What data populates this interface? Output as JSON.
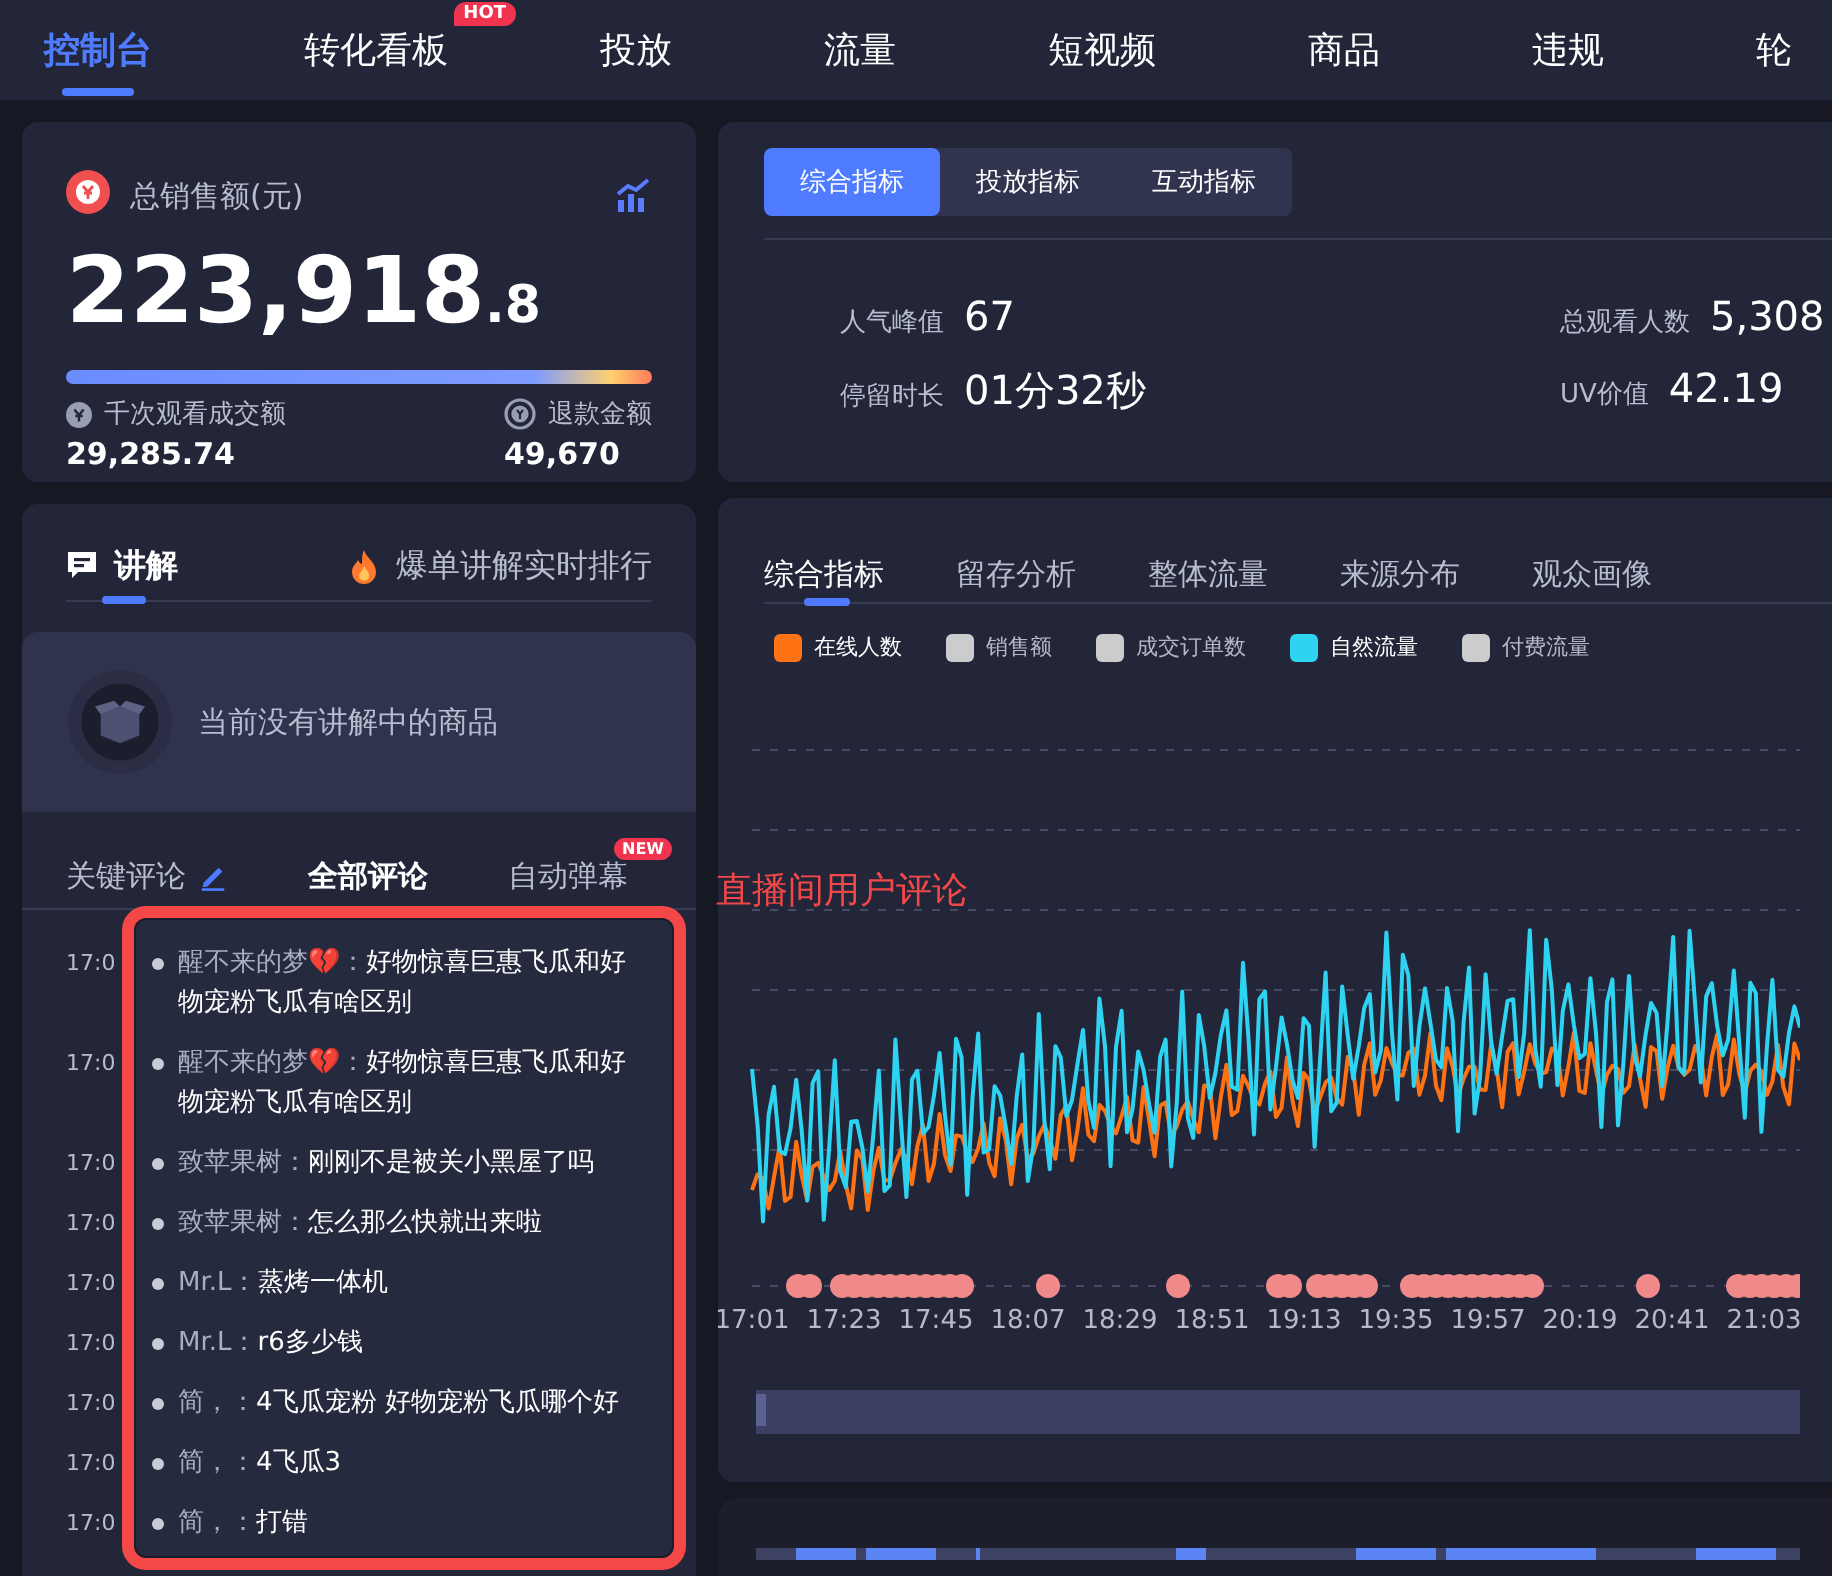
{
  "nav_tabs": [
    {
      "label": "控制台",
      "selected": true
    },
    {
      "label": "转化看板",
      "selected": false,
      "badge": "HOT"
    },
    {
      "label": "投放",
      "selected": false
    },
    {
      "label": "流量",
      "selected": false
    },
    {
      "label": "短视频",
      "selected": false
    },
    {
      "label": "商品",
      "selected": false
    },
    {
      "label": "违规",
      "selected": false
    },
    {
      "label": "轮",
      "selected": false
    }
  ],
  "sales_card": {
    "title": "总销售额(元)",
    "total_integer": "223,918",
    "total_decimal": ".8",
    "metrics": [
      {
        "kind": "gpm",
        "label": "千次观看成交额",
        "value": "29,285.74"
      },
      {
        "kind": "refund",
        "label": "退款金额",
        "value": "49,670"
      }
    ]
  },
  "metric_card": {
    "tabs": [
      {
        "label": "综合指标",
        "selected": true
      },
      {
        "label": "投放指标",
        "selected": false
      },
      {
        "label": "互动指标",
        "selected": false
      }
    ],
    "stats": [
      {
        "label": "人气峰值",
        "value": "67"
      },
      {
        "label": "总观看人数",
        "value": "5,308"
      },
      {
        "label": "停留时长",
        "value": "01分32秒"
      },
      {
        "label": "UV价值",
        "value": "42.19"
      }
    ]
  },
  "explain_panel": {
    "tabs": [
      {
        "kind": "chat",
        "label": "讲解",
        "selected": true
      },
      {
        "kind": "fire",
        "label": "爆单讲解实时排行",
        "selected": false
      }
    ],
    "empty_text": "当前没有讲解中的商品",
    "comment_tabs": [
      {
        "kind": "edit",
        "label": "关键评论",
        "selected": false
      },
      {
        "label": "全部评论",
        "selected": true
      },
      {
        "label": "自动弹幕",
        "selected": false,
        "badge": "NEW"
      }
    ],
    "comments": [
      {
        "time": "17:0",
        "author": "醒不来的梦💔：",
        "text": "好物惊喜巨惠飞瓜和好物宠粉飞瓜有啥区别"
      },
      {
        "time": "17:0",
        "author": "醒不来的梦💔：",
        "text": "好物惊喜巨惠飞瓜和好物宠粉飞瓜有啥区别"
      },
      {
        "time": "17:0",
        "author": "致苹果树：",
        "text": "刚刚不是被关小黑屋了吗"
      },
      {
        "time": "17:0",
        "author": "致苹果树：",
        "text": "怎么那么快就出来啦"
      },
      {
        "time": "17:0",
        "author": "Mr.L：",
        "text": "蒸烤一体机"
      },
      {
        "time": "17:0",
        "author": "Mr.L：",
        "text": "r6多少钱"
      },
      {
        "time": "17:0",
        "author": "简，：",
        "text": "4飞瓜宠粉 好物宠粉飞瓜哪个好"
      },
      {
        "time": "17:0",
        "author": "简，：",
        "text": "4飞瓜3"
      },
      {
        "time": "17:0",
        "author": "简，：",
        "text": "打错"
      }
    ]
  },
  "annotation": {
    "label": "直播间用户评论"
  },
  "trend_card": {
    "tabs": [
      {
        "label": "综合指标",
        "selected": true
      },
      {
        "label": "留存分析",
        "selected": false
      },
      {
        "label": "整体流量",
        "selected": false
      },
      {
        "label": "来源分布",
        "selected": false
      },
      {
        "label": "观众画像",
        "selected": false
      }
    ],
    "legend": [
      {
        "label": "在线人数",
        "on": true,
        "color": "#ff7214"
      },
      {
        "label": "销售额",
        "on": false
      },
      {
        "label": "成交订单数",
        "on": false
      },
      {
        "label": "自然流量",
        "on": true,
        "color": "#2fd3f2"
      },
      {
        "label": "付费流量",
        "on": false
      }
    ],
    "range_slider": {
      "level": 1
    },
    "x_labels": [
      "17:01",
      "17:23",
      "17:45",
      "18:07",
      "18:29",
      "18:51",
      "19:13",
      "19:35",
      "19:57",
      "20:19",
      "20:41",
      "21:03"
    ]
  }
}
